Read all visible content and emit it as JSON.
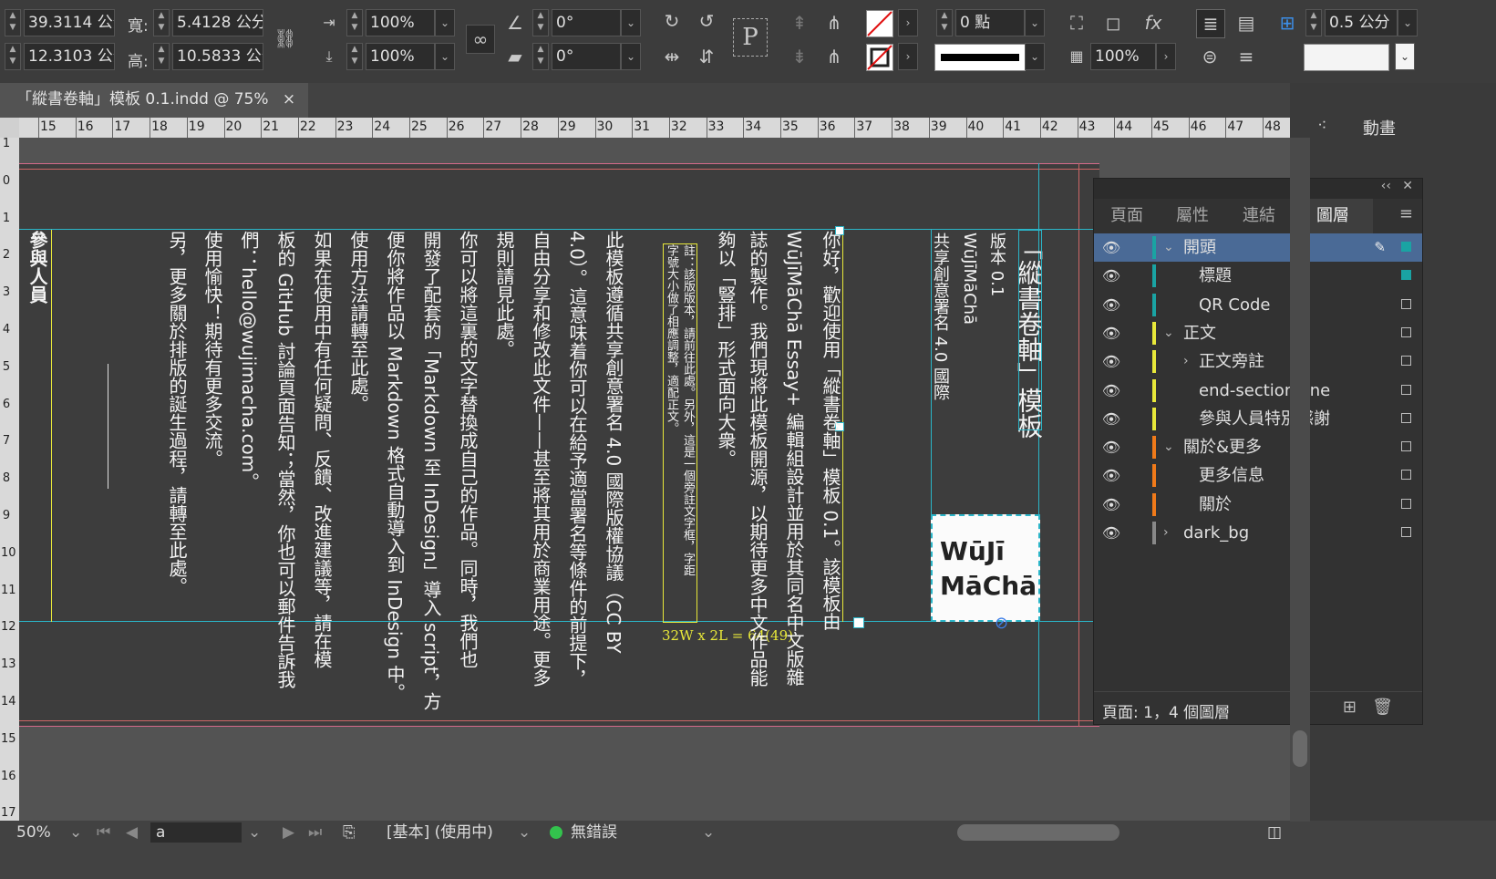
{
  "control_bar": {
    "x_value": "39.3114 公分",
    "y_value": "12.3103 公分",
    "width_label": "寬:",
    "width_value": "5.4128 公分",
    "height_label": "高:",
    "height_value": "10.5833 公分",
    "scale_x": "100%",
    "scale_y": "100%",
    "rotate": "0°",
    "shear": "0°",
    "stroke_weight": "0 點",
    "opacity": "100%",
    "frame_spacing": "0.5 公分"
  },
  "document_tab": {
    "title": "「縱書卷軸」模板 0.1.indd @ 75%",
    "close": "×"
  },
  "ruler_h": [
    "15",
    "16",
    "17",
    "18",
    "19",
    "20",
    "21",
    "22",
    "23",
    "24",
    "25",
    "26",
    "27",
    "28",
    "29",
    "30",
    "31",
    "32",
    "33",
    "34",
    "35",
    "36",
    "37",
    "38",
    "39",
    "40",
    "41",
    "42",
    "43",
    "44",
    "45",
    "46",
    "47",
    "48"
  ],
  "ruler_v": [
    "1",
    "0",
    "1",
    "2",
    "3",
    "4",
    "5",
    "6",
    "7",
    "8",
    "9",
    "10",
    "11",
    "12",
    "13",
    "14",
    "15",
    "16",
    "17"
  ],
  "page": {
    "title_col": "「縱書卷軸」模板",
    "version": "版本 0.1",
    "author": "WūJīMāChā",
    "license_short": "共享創意署名 4.0 國際",
    "logo_line1": "WūJī",
    "logo_line2": "MāChā",
    "frame_info": "32W x 2L = 64(49)",
    "cols": [
      "你好，歡迎使用「縱書卷軸」模板 0.1。該模板由",
      "WūJīMāChā Essay+ 編輯組設計並用於其同名中文版雜",
      "誌的製作。我們現將此模板開源，以期待更多中文作品能",
      "夠以「豎排」形式面向大衆。",
      "此模板遵循共享創意署名 4.0 國際版權協議（CC BY",
      "4.0）。這意味着你可以在給予適當署名等條件的前提下，",
      "自由分享和修改此文件——甚至將其用於商業用途。更多",
      "規則請見此處。",
      "你可以將這裏的文字替換成自己的作品。同時，我們也",
      "開發了配套的「Markdown 至 InDesign」導入 script，方",
      "便你將作品以 Markdown 格式自動導入到 InDesign 中。",
      "使用方法請轉至此處。",
      "如果在使用中有任何疑問、反饋、改進建議等，請在模",
      "板的 GitHub 討論頁面告知；當然，你也可以郵件告訴我",
      "們：hello@wujimacha.com。",
      "使用愉快！期待有更多交流。",
      "另，更多關於排版的誕生過程，請轉至此處。"
    ],
    "note_col1": "註：該版版本，請前往此處。另外，這是一個旁註文字框，字距",
    "note_col2": "字號大小做了相應調整，適配正文。",
    "participants": "參與人員"
  },
  "layers_panel": {
    "tabs": [
      "頁面",
      "屬性",
      "連結",
      "圖層"
    ],
    "active_tab": "圖層",
    "layers": [
      {
        "name": "開頭",
        "indent": 0,
        "expanded": true,
        "color": "#1aa3a3",
        "selected": true
      },
      {
        "name": "標題",
        "indent": 1,
        "color": "#1aa3a3"
      },
      {
        "name": "QR Code",
        "indent": 1,
        "color": "#1aa3a3"
      },
      {
        "name": "正文",
        "indent": 0,
        "expanded": true,
        "color": "#e8e83a"
      },
      {
        "name": "正文旁註",
        "indent": 1,
        "collapsed": true,
        "color": "#e8e83a"
      },
      {
        "name": "end-section-line",
        "indent": 1,
        "color": "#e8e83a"
      },
      {
        "name": "參與人員特別感謝",
        "indent": 1,
        "color": "#e8e83a"
      },
      {
        "name": "關於&更多",
        "indent": 0,
        "expanded": true,
        "color": "#f07a1a"
      },
      {
        "name": "更多信息",
        "indent": 1,
        "color": "#f07a1a"
      },
      {
        "name": "關於",
        "indent": 1,
        "color": "#f07a1a"
      },
      {
        "name": "dark_bg",
        "indent": 0,
        "collapsed": true,
        "color": "#888888"
      }
    ],
    "footer": "頁面: 1，4 個圖層"
  },
  "dock": {
    "animation_label": "動畫"
  },
  "status_bar": {
    "zoom": "50%",
    "page": "a",
    "profile": "[基本] (使用中)",
    "preflight": "無錯誤"
  }
}
